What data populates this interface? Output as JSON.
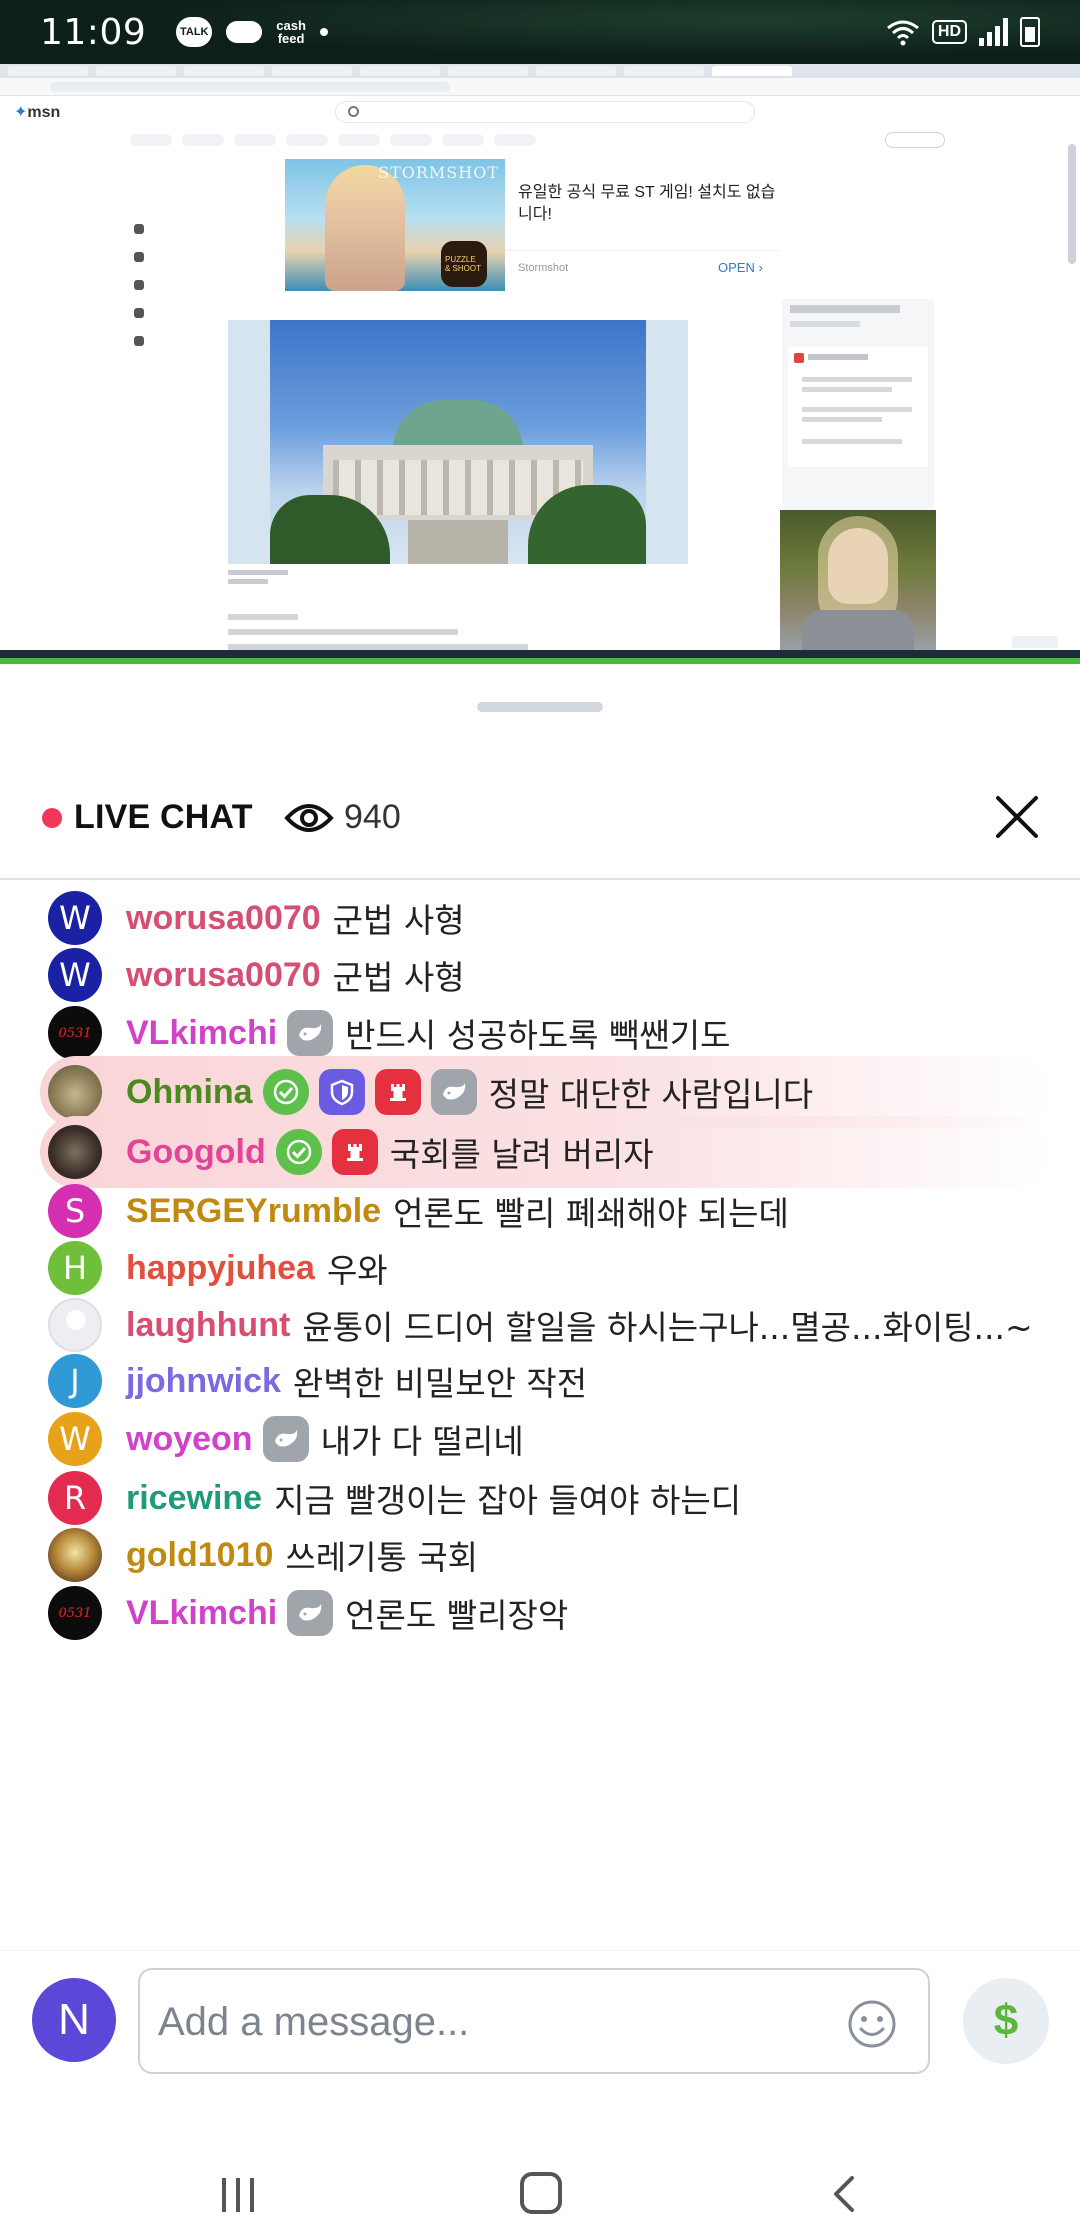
{
  "status_bar": {
    "time": "11:09",
    "talk_label": "TALK",
    "cash_label": "cash\nfeed",
    "hd_label": "HD"
  },
  "stream": {
    "msn_logo": "msn",
    "ad": {
      "brand": "STORMSHOT",
      "badge": "PUZZLE & SHOOT",
      "text": "유일한 공식 무료 ST 게임! 설치도 없습니다!",
      "source": "Stormshot",
      "open_label": "OPEN ›"
    }
  },
  "chat": {
    "live_label": "LIVE CHAT",
    "viewer_count": "940",
    "messages": [
      {
        "username": "worusa0070",
        "text": "군법 사형",
        "avatar_letter": "W",
        "avatar_color": "#1a22a3",
        "name_color": "#d64f73"
      },
      {
        "username": "worusa0070",
        "text": "군법 사형",
        "avatar_letter": "W",
        "avatar_color": "#1a22a3",
        "name_color": "#d64f73"
      },
      {
        "username": "VLkimchi",
        "text": "반드시 성공하도록 빽쌘기도",
        "avatar_letter": "0531",
        "name_color": "#d042c9"
      },
      {
        "username": "Ohmina",
        "text": "정말 대단한 사람입니다",
        "name_color": "#4a8a1f"
      },
      {
        "username": "Googold",
        "text": "국회를 날려 버리자",
        "name_color": "#e2449a"
      },
      {
        "username": "SERGEYrumble",
        "text": "언론도 빨리 폐쇄해야 되는데",
        "avatar_letter": "S",
        "avatar_color": "#d42fb0",
        "name_color": "#c08a12"
      },
      {
        "username": "happyjuhea",
        "text": "우와",
        "avatar_letter": "H",
        "avatar_color": "#6fbf3a",
        "name_color": "#e0503c"
      },
      {
        "username": "laughhunt",
        "text": "윤통이 드디어 할일을 하시는구나...멸공...화이팅...~",
        "name_color": "#d64f73"
      },
      {
        "username": "jjohnwick",
        "text": "완벽한 비밀보안 작전",
        "avatar_letter": "J",
        "avatar_color": "#2f9ad6",
        "name_color": "#7b6ae0"
      },
      {
        "username": "woyeon",
        "text": "내가 다 떨리네",
        "avatar_letter": "W",
        "avatar_color": "#e8a21a",
        "name_color": "#d042c9"
      },
      {
        "username": "ricewine",
        "text": "지금 빨갱이는 잡아 들여야 하는디",
        "avatar_letter": "R",
        "avatar_color": "#e22b4f",
        "name_color": "#1f9a7a"
      },
      {
        "username": "gold1010",
        "text": "쓰레기통 국회",
        "name_color": "#c08a12"
      },
      {
        "username": "VLkimchi",
        "text": "언론도 빨리장악",
        "avatar_letter": "0531",
        "name_color": "#d042c9"
      }
    ]
  },
  "composer": {
    "avatar_letter": "N",
    "placeholder": "Add a message...",
    "tip_symbol": "$"
  }
}
